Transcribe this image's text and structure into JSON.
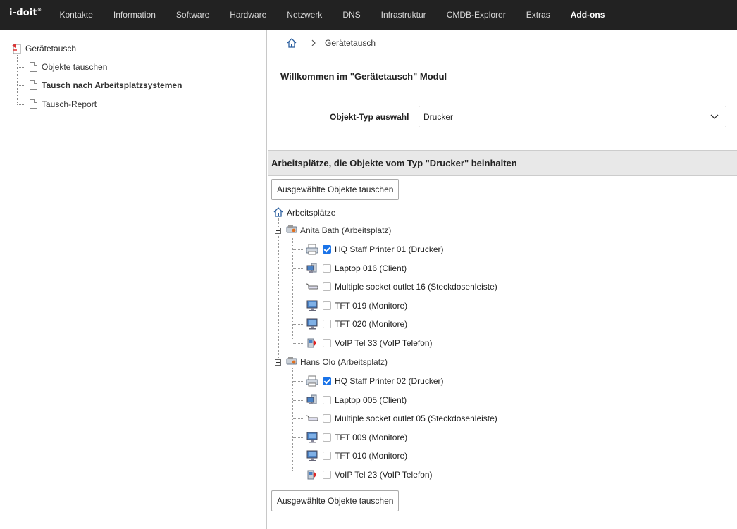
{
  "topbar": {
    "logo": "i-doit",
    "nav": [
      "Kontakte",
      "Information",
      "Software",
      "Hardware",
      "Netzwerk",
      "DNS",
      "Infrastruktur",
      "CMDB-Explorer",
      "Extras",
      "Add-ons"
    ],
    "active": "Add-ons"
  },
  "sidebar": {
    "root": "Gerätetausch",
    "items": [
      {
        "label": "Objekte tauschen",
        "active": false
      },
      {
        "label": "Tausch nach Arbeitsplatzsystemen",
        "active": true
      },
      {
        "label": "Tausch-Report",
        "active": false
      }
    ]
  },
  "breadcrumb": {
    "current": "Gerätetausch",
    "separator": ">"
  },
  "welcome": "Willkommen im \"Gerätetausch\" Modul",
  "type_select": {
    "label": "Objekt-Typ auswahl",
    "value": "Drucker"
  },
  "section_title": "Arbeitsplätze, die Objekte vom Typ \"Drucker\" beinhalten",
  "swap_button": "Ausgewählte Objekte tauschen",
  "tree": {
    "root": "Arbeitsplätze",
    "workplaces": [
      {
        "label": "Anita Bath (Arbeitsplatz)",
        "items": [
          {
            "label": "HQ Staff Printer 01 (Drucker)",
            "icon": "printer-icon",
            "checked": true
          },
          {
            "label": "Laptop 016 (Client)",
            "icon": "client-icon",
            "checked": false
          },
          {
            "label": "Multiple socket outlet 16 (Steckdosenleiste)",
            "icon": "power-strip-icon",
            "checked": false
          },
          {
            "label": "TFT 019 (Monitore)",
            "icon": "monitor-icon",
            "checked": false
          },
          {
            "label": "TFT 020 (Monitore)",
            "icon": "monitor-icon",
            "checked": false
          },
          {
            "label": "VoIP Tel 33 (VoIP Telefon)",
            "icon": "voip-phone-icon",
            "checked": false
          }
        ]
      },
      {
        "label": "Hans Olo (Arbeitsplatz)",
        "items": [
          {
            "label": "HQ Staff Printer 02 (Drucker)",
            "icon": "printer-icon",
            "checked": true
          },
          {
            "label": "Laptop 005 (Client)",
            "icon": "client-icon",
            "checked": false
          },
          {
            "label": "Multiple socket outlet 05 (Steckdosenleiste)",
            "icon": "power-strip-icon",
            "checked": false
          },
          {
            "label": "TFT 009 (Monitore)",
            "icon": "monitor-icon",
            "checked": false
          },
          {
            "label": "TFT 010 (Monitore)",
            "icon": "monitor-icon",
            "checked": false
          },
          {
            "label": "VoIP Tel 23 (VoIP Telefon)",
            "icon": "voip-phone-icon",
            "checked": false
          }
        ]
      }
    ]
  },
  "colors": {
    "topbar": "#222222",
    "accent": "#1a73e8",
    "section_bg": "#e8e8e8"
  }
}
